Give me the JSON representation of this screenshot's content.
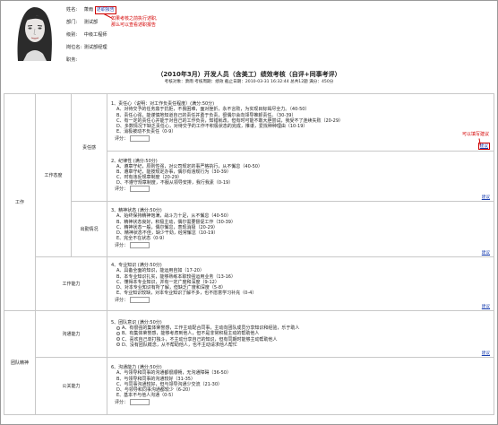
{
  "employee": {
    "name_label": "姓名:",
    "name": "萧雨",
    "report_link": "述职报告",
    "dept_label": "部门:",
    "dept": "测试部",
    "level_label": "级别:",
    "level": "中级工程师",
    "post_label": "岗位名:",
    "post": "测试部经理",
    "duty_label": "职务:",
    "duty": ""
  },
  "callouts": {
    "report_tip_1": "如果考核之前执行述职,",
    "report_tip_2": "那么可以查看述职报告",
    "suggest_tip": "可以填写建议"
  },
  "title": "（2010年3月）开发人员（含美工）绩效考核（自评+同事考评）",
  "meta": "考核对象：萧雨   考核周期：绩效   截止日期：2010-03-31 16:32:44   总共12题   满分：450分",
  "score_label": "评分：",
  "suggest_label": "建议",
  "categories": {
    "work": "工作",
    "team": "团队精神",
    "attitude": "工作态度",
    "ability": "工作能力",
    "comm": "沟通能力",
    "public": "公关能力",
    "responsibility": "责任感",
    "attendance": "出勤情况"
  },
  "questions": [
    {
      "title": "1、责任心（说明：对工作负责任程度）(满分:50分)",
      "options": [
        "A、对待交予的任务鼎于抗拒，不畏困难，面对挫折，永不言败，为实现目标竭尽全力。（40-50）",
        "B、责任心强，能谨慎地知道自己的责任并勇于负责，很偶尔会向领导推卸责任。（30-39）",
        "C、有一定的责任心并能于对自己的工作负责，知错就改，但有时可能不敢大胆尝试，我受不了连续失败（20-29）",
        "D、多数情况下缺乏责任心，对待交予的工作不积极状态的完成，推诿，爱找种种理由（10-19）",
        "E、消极被动不负责任（0-9）"
      ],
      "radio": false
    },
    {
      "title": "2、纪律性 (满分:50分)",
      "options": [
        "A、遵章守纪，原则性强，对公司规定的事严格执行，从不懈怠（40-50）",
        "B、遵章守纪，能按规定办事，偶尔有违规行为（30-39）",
        "C、时有违反规章制度（20-29）",
        "D、不遵守规章制度，不服从领导安排，我行我素（0-19）"
      ],
      "radio": false
    },
    {
      "title": "3、精神状态 (满分:50分)",
      "options": [
        "A、始终保持精神饱满，战斗力十足，从不懈怠（40-50）",
        "B、精神状态良好，积极主动，偶尔需要督促工作（30-39）",
        "C、精神状态一般，偶尔懈怠，表现消极（20-29）",
        "D、精神状态不佳，缺少干劲，经常懈怠（10-19）",
        "E、完全不在状态（0-9）"
      ],
      "radio": false
    },
    {
      "title": "4、专业知识 (满分:50分)",
      "options": [
        "A、具备全面的知识，能运用自如（17-20）",
        "B、本专业知识扎实，能够熟练本职较强运用业务（13-16）",
        "C、懂得本专业知识，并有一定广度和深度（9-12）",
        "D、对本专业知识有所了解，但缺乏广度和深度（5-8）",
        "E、专业知识较缺，对本专业知识了解不多，也不愿意学习补充（0-4）"
      ],
      "radio": false
    },
    {
      "title": "5、团队意识 (满分:50分)",
      "options": [
        "A、有很强的集体荣誉感，工作主动配合同事，主动向团队成员分享知识和经验，乐于助人",
        "B、有集体荣誉感，能够考虑到他人，但不是非常积极主动的帮助他人",
        "C、喜欢自己单打独斗，不主动分享自己的知识，但有同期时能够主动帮助他人",
        "D、没有团队概念，从不帮助他人，也不主动请求他人帮忙"
      ],
      "radio": true
    },
    {
      "title": "6、沟通能力 (满分:50分)",
      "options": [
        "A、与领导和同事的沟通都很顺畅，无沟通障碍（36-50）",
        "B、与领导和同事的沟通较好（31-35）",
        "C、与同事沟通较好，但与领导沟通少交流（21-30）",
        "D、与领导和同事沟通都较少（6-20）",
        "E、基本不与他人沟通（0-5）"
      ],
      "radio": false
    }
  ]
}
